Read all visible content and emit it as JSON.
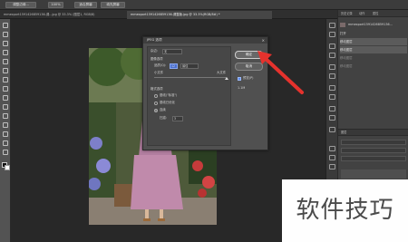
{
  "options_bar": {
    "buttons": [
      "调整边缘...",
      "100%",
      "适合屏幕",
      "填充屏幕"
    ]
  },
  "document_tabs": [
    {
      "label": "mmexport1591426859136-调...jpg @ 33.3% (图层1, RGB/8)",
      "active": false
    },
    {
      "label": "mmexport1591426859136-调整版.jpg @ 33.3%(RGB/8#) *",
      "active": true
    }
  ],
  "history_panel": {
    "tabs": [
      "历史记录",
      "动作",
      "属性"
    ],
    "rows": [
      {
        "label": "mmexport1591426859136...",
        "selected": false
      },
      {
        "label": "打开",
        "selected": false
      },
      {
        "label": "移动图层",
        "selected": true
      },
      {
        "label": "移动图层",
        "selected": true
      },
      {
        "label": "移动图层",
        "selected": false
      },
      {
        "label": "移动图层",
        "selected": false
      }
    ]
  },
  "layers_panel": {
    "tab": "图层"
  },
  "dialog": {
    "title": "JPEG 选项",
    "close_glyph": "×",
    "matte_label": "杂边:",
    "matte_value": "无",
    "image_options_label": "图像选项",
    "quality_label": "品质(Q):",
    "quality_value": "12",
    "quality_preset": "最佳",
    "small_file_label": "小文件",
    "large_file_label": "大文件",
    "quality_slider_value": 1.0,
    "format_options_label": "格式选项",
    "format_options": [
      {
        "label": "基线(\"标准\")",
        "checked": false
      },
      {
        "label": "基线已优化",
        "checked": false
      },
      {
        "label": "连续",
        "checked": true
      }
    ],
    "scans_label": "扫描:",
    "scans_value": "3",
    "ok_label": "确定",
    "cancel_label": "取消",
    "preview_label": "预览(P)",
    "preview_checked": true,
    "file_size": "1.1M"
  },
  "watermark": {
    "text": "软件技巧"
  },
  "annotation": {
    "arrow_color": "#e5322d"
  }
}
